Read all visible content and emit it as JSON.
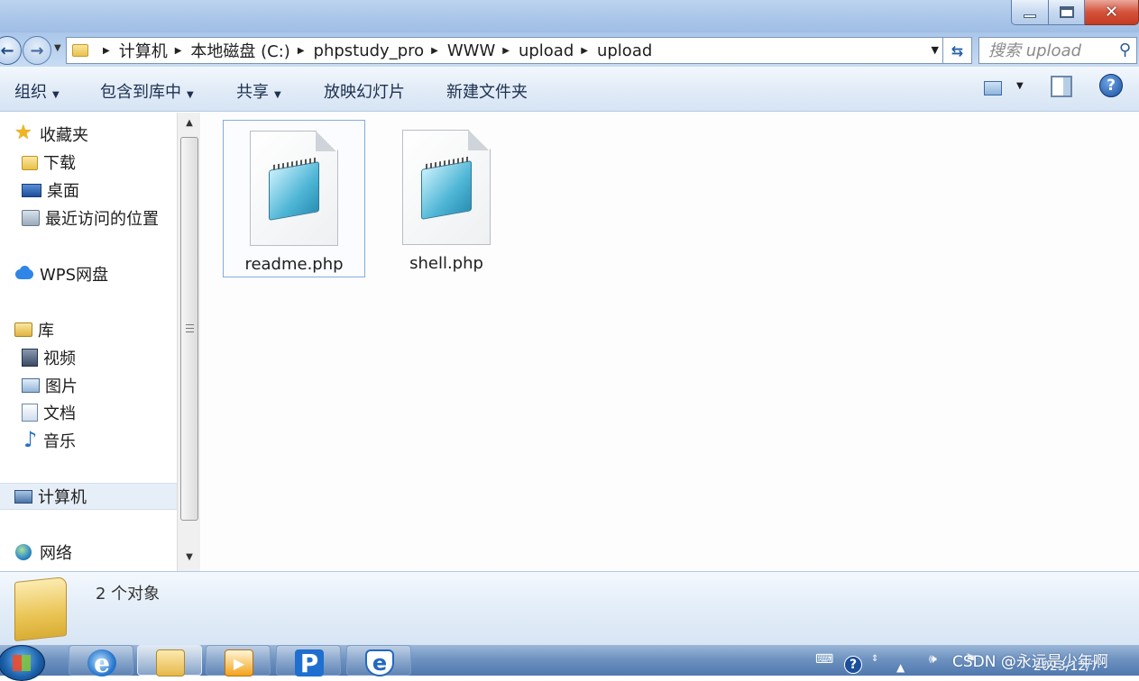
{
  "address": {
    "crumbs": [
      "计算机",
      "本地磁盘 (C:)",
      "phpstudy_pro",
      "WWW",
      "upload",
      "upload"
    ],
    "search_placeholder": "搜索 upload"
  },
  "toolbar": {
    "organize": "组织",
    "include_library": "包含到库中",
    "share": "共享",
    "slideshow": "放映幻灯片",
    "new_folder": "新建文件夹"
  },
  "nav": {
    "favorites": "收藏夹",
    "downloads": "下载",
    "desktop": "桌面",
    "recent": "最近访问的位置",
    "wps": "WPS网盘",
    "libraries": "库",
    "videos": "视频",
    "pictures": "图片",
    "documents": "文档",
    "music": "音乐",
    "computer": "计算机",
    "network": "网络"
  },
  "files": [
    {
      "name": "readme.php",
      "icon": "notepad-file-icon"
    },
    {
      "name": "shell.php",
      "icon": "notepad-file-icon"
    }
  ],
  "details": {
    "count": "2 个对象"
  },
  "taskbar": {
    "clock": "2023/12/7",
    "watermark": "CSDN @永远是少年啊"
  },
  "colors": {
    "accent": "#84acdd",
    "titlebar": "#a9c5e8",
    "close": "#c43b22"
  }
}
